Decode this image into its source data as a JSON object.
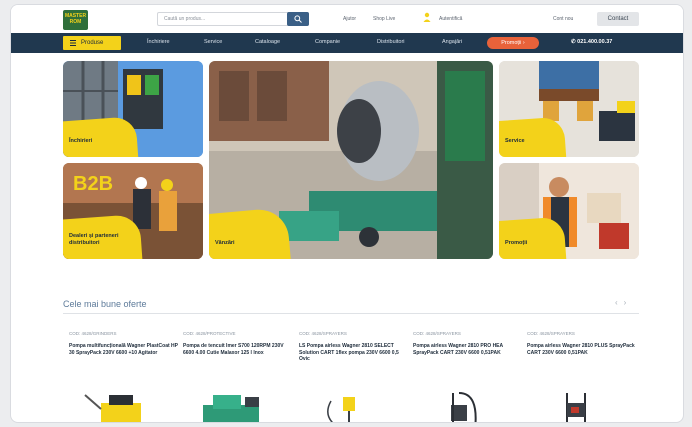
{
  "topbar": {
    "search_placeholder": "Caută un produs...",
    "items": [
      "Ajutor",
      "Shop Live",
      "Autentifică",
      "Cont nou"
    ],
    "contact": "Contact"
  },
  "nav": {
    "products": "Produse",
    "links": [
      "Închiriere",
      "Service",
      "Cataloage",
      "Companie",
      "Distribuitori",
      "Angajări"
    ],
    "promo": "Promoții",
    "phone": "021.400.00.37"
  },
  "tiles": {
    "inchirieri": "Închirieri",
    "distribuitori_line1": "Dealeri și parteneri",
    "distribuitori_line2": "distribuitori",
    "b2b": "B2B",
    "vanzari": "Vânzări",
    "service": "Service",
    "promotii": "Promoții"
  },
  "offers": {
    "title": "Cele mai bune oferte",
    "cards": [
      {
        "category": "Cod: 4628/GRINDERS",
        "name": "Pompa multifuncțională Wagner PlastCoat HP 30 SprayPack 230V 6600 +10 Agitator"
      },
      {
        "category": "Cod: 4628/PROTECTIVE",
        "name": "Pompa de tencuit Imer S700 120RPM 230V 6600 4.00 Cutie Malaxor 125 l Inox"
      },
      {
        "category": "Cod: 4628/SPRAYERS",
        "name": "LS Pompa airless Wagner 2810 SELECT Solution CART 1flex pompa 230V 6600 0,5 Ovic"
      },
      {
        "category": "Cod: 4628/SPRAYERS",
        "name": "Pompa airless Wagner 2810 PRO HEA SprayPack CART 230V 6600 0,51PAK"
      },
      {
        "category": "Cod: 4628/SPRAYERS",
        "name": "Pompa airless Wagner 2810 PLUS SprayPack CART 230V 6600 0,51PAK"
      }
    ]
  },
  "colors": {
    "navy": "#20384f",
    "yellow": "#f3d21a",
    "orange": "#e8623a"
  }
}
